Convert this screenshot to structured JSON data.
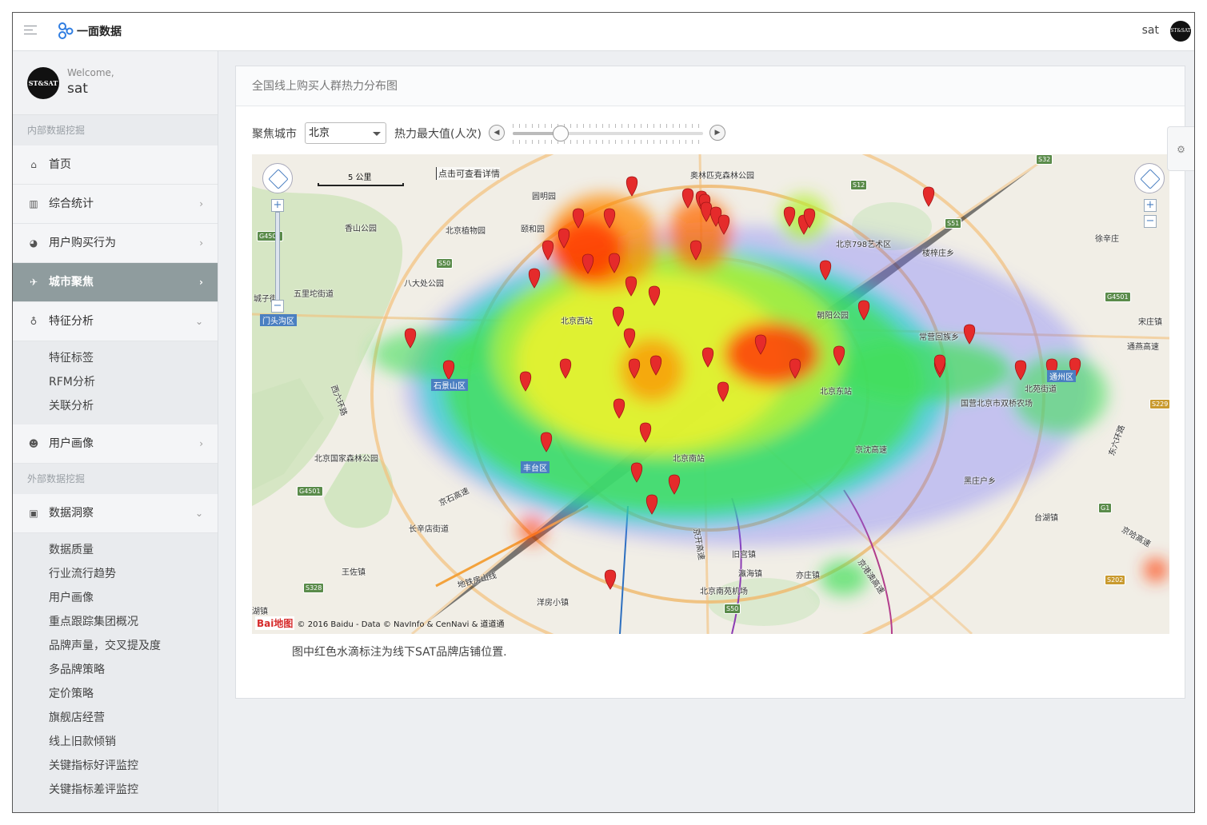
{
  "topbar": {
    "brand": "一面数据",
    "user": "sat"
  },
  "sidebar": {
    "welcome_label": "Welcome,",
    "welcome_user": "sat",
    "avatar_text": "ST&SAT",
    "section_internal": "内部数据挖掘",
    "section_external": "外部数据挖掘",
    "nav": {
      "home": "首页",
      "stats": "综合统计",
      "behavior": "用户购买行为",
      "city": "城市聚焦",
      "feature": "特征分析",
      "portrait": "用户画像",
      "insight": "数据洞察"
    },
    "feature_sub": [
      "特征标签",
      "RFM分析",
      "关联分析"
    ],
    "insight_sub": [
      "数据质量",
      "行业流行趋势",
      "用户画像",
      "重点跟踪集团概况",
      "品牌声量，交叉提及度",
      "多品牌策略",
      "定价策略",
      "旗舰店经营",
      "线上旧款倾销",
      "关键指标好评监控",
      "关键指标差评监控"
    ]
  },
  "panel": {
    "title": "全国线上购买人群热力分布图",
    "city_label": "聚焦城市",
    "city_value": "北京",
    "heat_label": "热力最大值(人次)",
    "slider_fraction": 0.25,
    "note": "图中红色水滴标注为线下SAT品牌店铺位置."
  },
  "map": {
    "scale": "5 公里",
    "hint": "点击可查看详情",
    "copyright": "© 2016 Baidu - Data © NavInfo & CenNavi & 道道通",
    "baidu_logo": "Bai地图",
    "labels": [
      "门头沟区",
      "五里坨街道",
      "城子街",
      "香山公园",
      "北京植物园",
      "颐和园",
      "圆明园",
      "八大处公园",
      "奥林匹克森林公园",
      "北京798艺术区",
      "楼梓庄乡",
      "徐辛庄",
      "朝阳公园",
      "常营回族乡",
      "宋庄镇",
      "通燕高速",
      "北苑街道",
      "北京东站",
      "国营北京市双桥农场",
      "京沈高速",
      "北京南站",
      "北京国家森林公园",
      "长辛店街道",
      "王佐镇",
      "旧宫镇",
      "瀛海镇",
      "亦庄镇",
      "北京南苑机场",
      "洋房小镇",
      "黑庄户乡",
      "台湖镇",
      "湖镇",
      "石景山区",
      "丰台区",
      "通州区",
      "北京西站",
      "京石高速",
      "京开高速",
      "京港澳高速",
      "京哈高速",
      "东六环路",
      "西六环路",
      "地铁房山线"
    ],
    "roads": [
      "G4501",
      "S50",
      "S12",
      "S51",
      "S32",
      "G1",
      "S202",
      "S328",
      "G4501",
      "S229",
      "S50",
      "G4501"
    ],
    "colors": {
      "marker": "#e52b2b",
      "heat_core": "#ff2a00"
    }
  }
}
